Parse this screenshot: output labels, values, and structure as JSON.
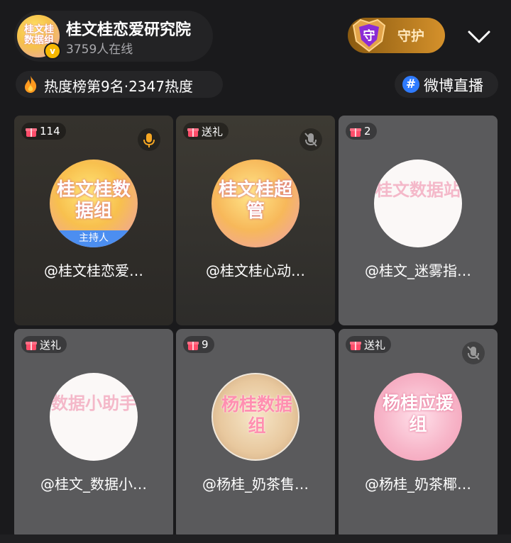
{
  "room": {
    "title": "桂文桂恋爱研究院",
    "online": "3759人在线",
    "avatar_text": "桂文桂数据组"
  },
  "guard": {
    "label": "守护",
    "badge_char": "守"
  },
  "heat": {
    "text": "热度榜第9名·2347热度"
  },
  "weibo": {
    "text": "微博直播",
    "hash": "#"
  },
  "colors": {
    "background": "#1a1a1c",
    "guard_gold": "#d5912b",
    "host_badge": "#4c8ef0",
    "weibo_blue": "#2f7bff"
  },
  "seats": [
    {
      "gift": "114",
      "mic": "mic-on-icon",
      "avatar_text": "桂文桂数据组",
      "host_badge": "主持人",
      "nickname": "@桂文桂恋爱…"
    },
    {
      "gift": "送礼",
      "mic": "mic-off-icon",
      "avatar_text": "桂文桂超管",
      "nickname": "@桂文桂心动…"
    },
    {
      "gift": "2",
      "avatar_text": "桂文数据站",
      "nickname": "@桂文_迷雾指…"
    },
    {
      "gift": "送礼",
      "avatar_text": "数据小助手",
      "nickname": "@桂文_数据小…"
    },
    {
      "gift": "9",
      "avatar_text": "杨桂数据组",
      "nickname": "@杨桂_奶茶售…"
    },
    {
      "gift": "送礼",
      "mic": "mic-off-icon",
      "avatar_text": "杨桂应援组",
      "nickname": "@杨桂_奶茶椰…"
    }
  ]
}
